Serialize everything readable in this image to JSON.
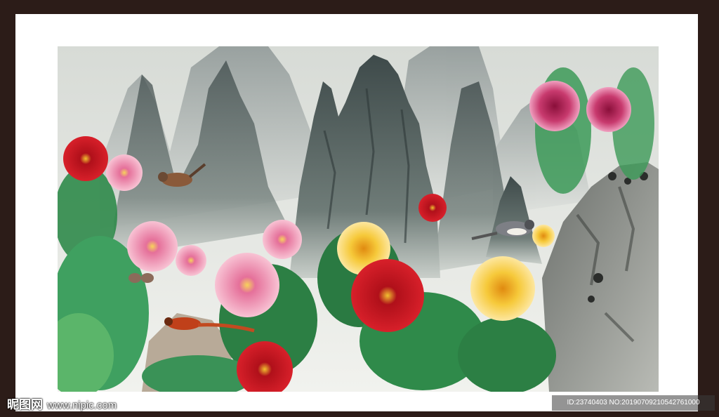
{
  "watermark": {
    "logo_text": "昵图网",
    "site": "www.nipic.com",
    "id_text": "ID:23740403 NO:20190709210542761000"
  },
  "colors": {
    "frame": "#2c1c18",
    "mat": "#ffffff",
    "sky": "#e9ebe6",
    "mountain": "#5f6c6c",
    "peony_red": "#c4141c",
    "peony_pink": "#ef8fb0",
    "peony_yellow": "#f6c93a",
    "leaf": "#2f8a4a"
  },
  "icons": [
    "bird-icon",
    "peony-flower-icon",
    "mountain-icon"
  ]
}
